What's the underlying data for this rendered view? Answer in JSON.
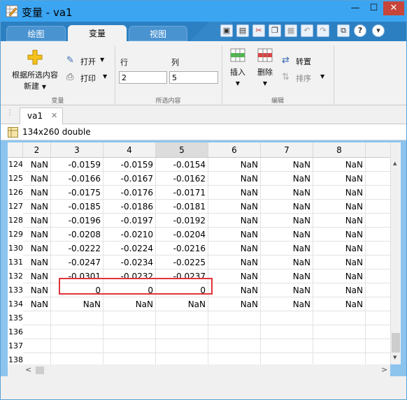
{
  "window": {
    "title": "变量 - va1",
    "min_glyph": "—",
    "max_glyph": "☐",
    "close_glyph": "✕"
  },
  "ribbon_tabs": [
    {
      "label": "绘图"
    },
    {
      "label": "变量"
    },
    {
      "label": "视图"
    }
  ],
  "quick_access": {
    "help_glyph": "?",
    "expand_glyph": "▾"
  },
  "ribbon": {
    "new_from_selection": "根据所选内容",
    "new_from_selection_2": "新建",
    "dropdown_glyph": "▼",
    "open": "打开",
    "print": "打印",
    "row_label": "行",
    "col_label": "列",
    "row_value": "2",
    "col_value": "5",
    "insert": "插入",
    "delete": "删除",
    "transpose": "转置",
    "sort": "排序",
    "group_variable": "变量",
    "group_selection": "所选内容",
    "group_edit": "编辑"
  },
  "doc_tab": {
    "label": "va1",
    "close_glyph": "✕"
  },
  "info": {
    "text": "134x260 double"
  },
  "grid": {
    "column_headers": [
      "2",
      "3",
      "4",
      "5",
      "6",
      "7",
      "8"
    ],
    "selected_column": "5",
    "rows": [
      {
        "n": "124",
        "c": [
          "NaN",
          "-0.0159",
          "-0.0159",
          "-0.0154",
          "NaN",
          "NaN",
          "NaN"
        ]
      },
      {
        "n": "125",
        "c": [
          "NaN",
          "-0.0166",
          "-0.0167",
          "-0.0162",
          "NaN",
          "NaN",
          "NaN"
        ]
      },
      {
        "n": "126",
        "c": [
          "NaN",
          "-0.0175",
          "-0.0176",
          "-0.0171",
          "NaN",
          "NaN",
          "NaN"
        ]
      },
      {
        "n": "127",
        "c": [
          "NaN",
          "-0.0185",
          "-0.0186",
          "-0.0181",
          "NaN",
          "NaN",
          "NaN"
        ]
      },
      {
        "n": "128",
        "c": [
          "NaN",
          "-0.0196",
          "-0.0197",
          "-0.0192",
          "NaN",
          "NaN",
          "NaN"
        ]
      },
      {
        "n": "129",
        "c": [
          "NaN",
          "-0.0208",
          "-0.0210",
          "-0.0204",
          "NaN",
          "NaN",
          "NaN"
        ]
      },
      {
        "n": "130",
        "c": [
          "NaN",
          "-0.0222",
          "-0.0224",
          "-0.0216",
          "NaN",
          "NaN",
          "NaN"
        ]
      },
      {
        "n": "131",
        "c": [
          "NaN",
          "-0.0247",
          "-0.0234",
          "-0.0225",
          "NaN",
          "NaN",
          "NaN"
        ]
      },
      {
        "n": "132",
        "c": [
          "NaN",
          "-0.0301",
          "-0.0232",
          "-0.0237",
          "NaN",
          "NaN",
          "NaN"
        ]
      },
      {
        "n": "133",
        "c": [
          "NaN",
          "0",
          "0",
          "0",
          "NaN",
          "NaN",
          "NaN"
        ]
      },
      {
        "n": "134",
        "c": [
          "NaN",
          "NaN",
          "NaN",
          "NaN",
          "NaN",
          "NaN",
          "NaN"
        ]
      },
      {
        "n": "135",
        "c": [
          "",
          "",
          "",
          "",
          "",
          "",
          ""
        ]
      },
      {
        "n": "136",
        "c": [
          "",
          "",
          "",
          "",
          "",
          "",
          ""
        ]
      },
      {
        "n": "137",
        "c": [
          "",
          "",
          "",
          "",
          "",
          "",
          ""
        ]
      },
      {
        "n": "138",
        "c": [
          "",
          "",
          "",
          "",
          "",
          "",
          ""
        ]
      }
    ]
  },
  "scroll": {
    "left_glyph": "<",
    "right_glyph": ">",
    "up_glyph": "▲",
    "down_glyph": "▼"
  },
  "colors": {
    "titlebar": "#3ba5f2",
    "tabstrip": "#2c80c2",
    "highlight": "#e2333a",
    "close": "#c7453a"
  }
}
